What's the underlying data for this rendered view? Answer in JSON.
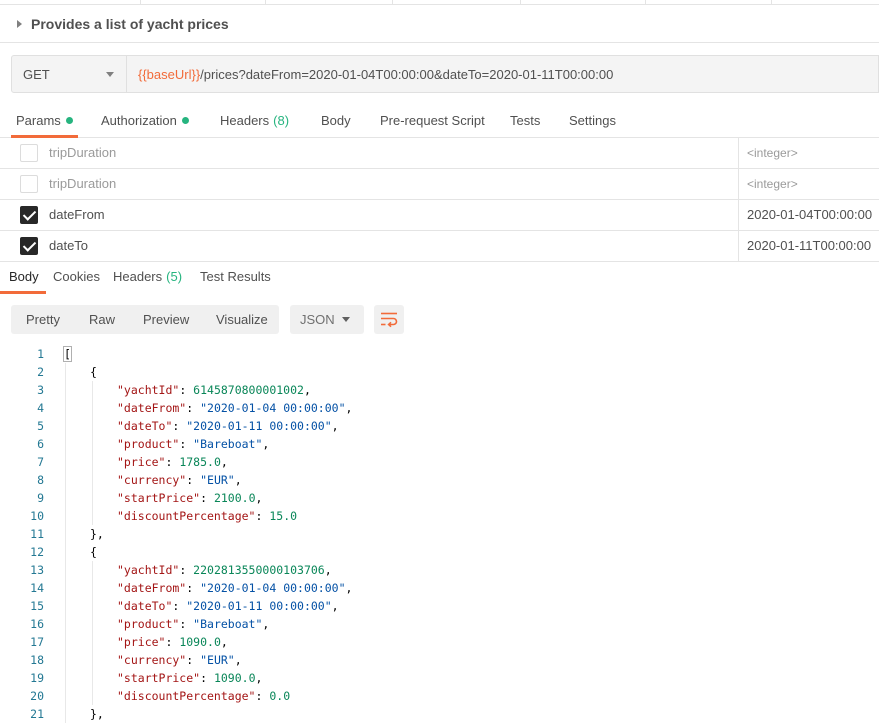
{
  "request": {
    "title": "Provides a list of yacht prices",
    "method": "GET",
    "url_variable": "{{baseUrl}}",
    "url_rest": "/prices?dateFrom=2020-01-04T00:00:00&dateTo=2020-01-11T00:00:00"
  },
  "request_tabs": {
    "params": "Params",
    "authorization": "Authorization",
    "headers": "Headers",
    "headers_count": "(8)",
    "body": "Body",
    "prerequest": "Pre-request Script",
    "tests": "Tests",
    "settings": "Settings"
  },
  "params": [
    {
      "checked": false,
      "key": "tripDuration",
      "value": "<integer>"
    },
    {
      "checked": false,
      "key": "tripDuration",
      "value": "<integer>"
    },
    {
      "checked": true,
      "key": "dateFrom",
      "value": "2020-01-04T00:00:00"
    },
    {
      "checked": true,
      "key": "dateTo",
      "value": "2020-01-11T00:00:00"
    }
  ],
  "response_tabs": {
    "body": "Body",
    "cookies": "Cookies",
    "headers": "Headers",
    "headers_count": "(5)",
    "test_results": "Test Results"
  },
  "view_modes": {
    "pretty": "Pretty",
    "raw": "Raw",
    "preview": "Preview",
    "visualize": "Visualize",
    "format": "JSON"
  },
  "code_lines": [
    {
      "n": "1",
      "indent": 0,
      "parts": [
        [
          "p",
          "["
        ]
      ]
    },
    {
      "n": "2",
      "indent": 1,
      "parts": [
        [
          "p",
          "{"
        ]
      ]
    },
    {
      "n": "3",
      "indent": 2,
      "parts": [
        [
          "k",
          "\"yachtId\""
        ],
        [
          "p",
          ": "
        ],
        [
          "n",
          "6145870800001002"
        ],
        [
          "p",
          ","
        ]
      ]
    },
    {
      "n": "4",
      "indent": 2,
      "parts": [
        [
          "k",
          "\"dateFrom\""
        ],
        [
          "p",
          ": "
        ],
        [
          "s",
          "\"2020-01-04 00:00:00\""
        ],
        [
          "p",
          ","
        ]
      ]
    },
    {
      "n": "5",
      "indent": 2,
      "parts": [
        [
          "k",
          "\"dateTo\""
        ],
        [
          "p",
          ": "
        ],
        [
          "s",
          "\"2020-01-11 00:00:00\""
        ],
        [
          "p",
          ","
        ]
      ]
    },
    {
      "n": "6",
      "indent": 2,
      "parts": [
        [
          "k",
          "\"product\""
        ],
        [
          "p",
          ": "
        ],
        [
          "s",
          "\"Bareboat\""
        ],
        [
          "p",
          ","
        ]
      ]
    },
    {
      "n": "7",
      "indent": 2,
      "parts": [
        [
          "k",
          "\"price\""
        ],
        [
          "p",
          ": "
        ],
        [
          "n",
          "1785.0"
        ],
        [
          "p",
          ","
        ]
      ]
    },
    {
      "n": "8",
      "indent": 2,
      "parts": [
        [
          "k",
          "\"currency\""
        ],
        [
          "p",
          ": "
        ],
        [
          "s",
          "\"EUR\""
        ],
        [
          "p",
          ","
        ]
      ]
    },
    {
      "n": "9",
      "indent": 2,
      "parts": [
        [
          "k",
          "\"startPrice\""
        ],
        [
          "p",
          ": "
        ],
        [
          "n",
          "2100.0"
        ],
        [
          "p",
          ","
        ]
      ]
    },
    {
      "n": "10",
      "indent": 2,
      "parts": [
        [
          "k",
          "\"discountPercentage\""
        ],
        [
          "p",
          ": "
        ],
        [
          "n",
          "15.0"
        ]
      ]
    },
    {
      "n": "11",
      "indent": 1,
      "parts": [
        [
          "p",
          "},"
        ]
      ]
    },
    {
      "n": "12",
      "indent": 1,
      "parts": [
        [
          "p",
          "{"
        ]
      ]
    },
    {
      "n": "13",
      "indent": 2,
      "parts": [
        [
          "k",
          "\"yachtId\""
        ],
        [
          "p",
          ": "
        ],
        [
          "n",
          "2202813550000103706"
        ],
        [
          "p",
          ","
        ]
      ]
    },
    {
      "n": "14",
      "indent": 2,
      "parts": [
        [
          "k",
          "\"dateFrom\""
        ],
        [
          "p",
          ": "
        ],
        [
          "s",
          "\"2020-01-04 00:00:00\""
        ],
        [
          "p",
          ","
        ]
      ]
    },
    {
      "n": "15",
      "indent": 2,
      "parts": [
        [
          "k",
          "\"dateTo\""
        ],
        [
          "p",
          ": "
        ],
        [
          "s",
          "\"2020-01-11 00:00:00\""
        ],
        [
          "p",
          ","
        ]
      ]
    },
    {
      "n": "16",
      "indent": 2,
      "parts": [
        [
          "k",
          "\"product\""
        ],
        [
          "p",
          ": "
        ],
        [
          "s",
          "\"Bareboat\""
        ],
        [
          "p",
          ","
        ]
      ]
    },
    {
      "n": "17",
      "indent": 2,
      "parts": [
        [
          "k",
          "\"price\""
        ],
        [
          "p",
          ": "
        ],
        [
          "n",
          "1090.0"
        ],
        [
          "p",
          ","
        ]
      ]
    },
    {
      "n": "18",
      "indent": 2,
      "parts": [
        [
          "k",
          "\"currency\""
        ],
        [
          "p",
          ": "
        ],
        [
          "s",
          "\"EUR\""
        ],
        [
          "p",
          ","
        ]
      ]
    },
    {
      "n": "19",
      "indent": 2,
      "parts": [
        [
          "k",
          "\"startPrice\""
        ],
        [
          "p",
          ": "
        ],
        [
          "n",
          "1090.0"
        ],
        [
          "p",
          ","
        ]
      ]
    },
    {
      "n": "20",
      "indent": 2,
      "parts": [
        [
          "k",
          "\"discountPercentage\""
        ],
        [
          "p",
          ": "
        ],
        [
          "n",
          "0.0"
        ]
      ]
    },
    {
      "n": "21",
      "indent": 1,
      "parts": [
        [
          "p",
          "},"
        ]
      ]
    }
  ],
  "colors": {
    "accent": "#f26b3a",
    "status_green": "#26b47f",
    "json_key": "#a31515",
    "json_string": "#0451a5",
    "json_number": "#098658",
    "line_number": "#237893"
  },
  "icons": {
    "collapse": "caret-right-icon",
    "method_dropdown": "chevron-down-icon",
    "format_dropdown": "chevron-down-icon",
    "wrap": "wrap-lines-icon"
  }
}
